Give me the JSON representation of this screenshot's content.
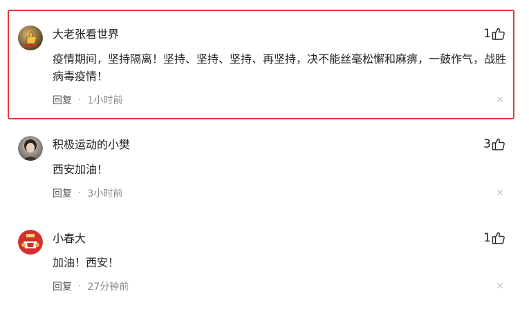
{
  "comments": [
    {
      "username": "大老张看世界",
      "likes": "1",
      "text": "疫情期间，坚持隔离！坚持、坚持、坚持、再坚持，决不能丝毫松懈和麻痹，一鼓作气，战胜病毒疫情！",
      "reply_label": "回复",
      "separator": "·",
      "time": "1小时前",
      "close": "✕",
      "highlighted": true
    },
    {
      "username": "积极运动的小樊",
      "likes": "3",
      "text": "西安加油！",
      "reply_label": "回复",
      "separator": "·",
      "time": "3小时前",
      "close": "✕",
      "highlighted": false
    },
    {
      "username": "小春大",
      "likes": "1",
      "text": "加油！西安！",
      "reply_label": "回复",
      "separator": "·",
      "time": "27分钟前",
      "close": "✕",
      "highlighted": false
    }
  ],
  "colors": {
    "highlight_border": "#e53935",
    "meta_text": "#888888",
    "close_icon": "#c8c8c8"
  }
}
